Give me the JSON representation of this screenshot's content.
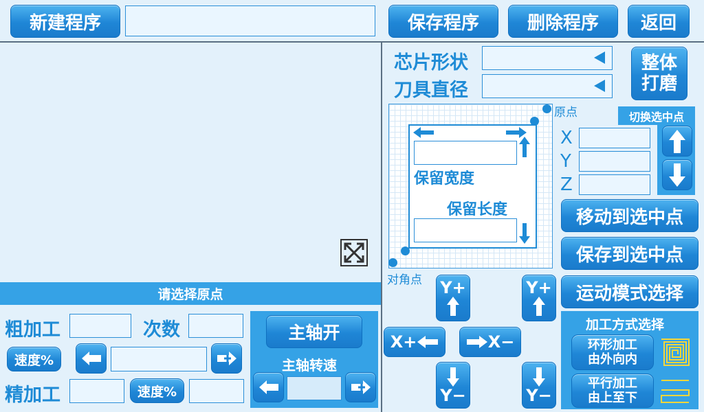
{
  "toolbar": {
    "new_program": "新建程序",
    "save_program": "保存程序",
    "delete_program": "删除程序",
    "back": "返回"
  },
  "chip": {
    "shape_label": "芯片形状",
    "tool_diameter_label": "刀具直径",
    "whole_grind": [
      "整体",
      "打磨"
    ]
  },
  "diagram": {
    "origin": "原点",
    "diagonal": "对角点",
    "keep_width": "保留宽度",
    "keep_length": "保留长度"
  },
  "select": {
    "switch_title": "切换选中点",
    "x": "X",
    "y": "Y",
    "z": "Z",
    "move_to": "移动到选中点",
    "save_to": "保存到选中点",
    "motion_mode": "运动模式选择"
  },
  "origin_bar": "请选择原点",
  "machining": {
    "rough": "粗加工",
    "count": "次数",
    "speed": "速度%",
    "fine": "精加工"
  },
  "spindle": {
    "on": "主轴开",
    "speed": "主轴转速"
  },
  "jog": {
    "y_plus": "Y+",
    "y_minus": "Y−",
    "x_plus": "X+",
    "x_minus": "X−"
  },
  "method": {
    "title": "加工方式选择",
    "ring": [
      "环形加工",
      "由外向内"
    ],
    "parallel": [
      "平行加工",
      "由上至下"
    ]
  },
  "colors": {
    "accent": "#1e8bd6",
    "background": "#e3f1fb",
    "bar": "#35a2e6"
  }
}
